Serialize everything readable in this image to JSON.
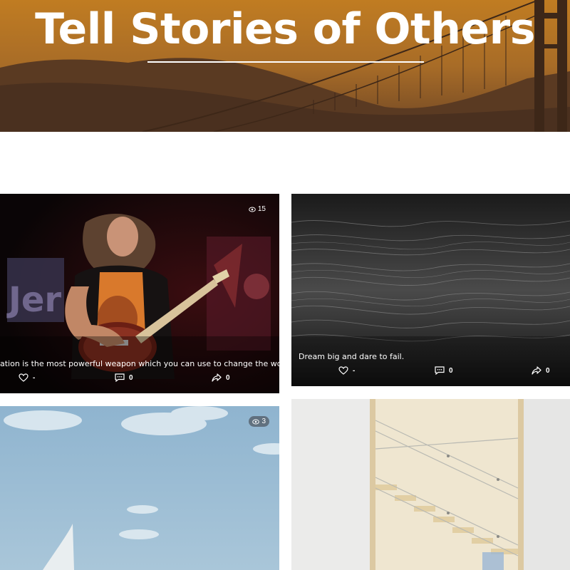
{
  "hero": {
    "title": "Tell Stories of Others"
  },
  "cards": [
    {
      "views": "15",
      "caption": "ation is the most powerful weapon which you can use to change the world.",
      "likes": "-",
      "comments": "0",
      "shares": "0"
    },
    {
      "caption": "Dream big and dare to fail.",
      "likes": "-",
      "comments": "0",
      "shares": "0"
    },
    {
      "views": "3"
    },
    {}
  ],
  "icons": [
    "eye-icon",
    "heart-icon",
    "comment-icon",
    "share-icon"
  ],
  "colors": {
    "hero_sky": "#b8761f",
    "hero_hills": "#4e3220",
    "text": "#ffffff",
    "page_bg": "#ffffff"
  }
}
